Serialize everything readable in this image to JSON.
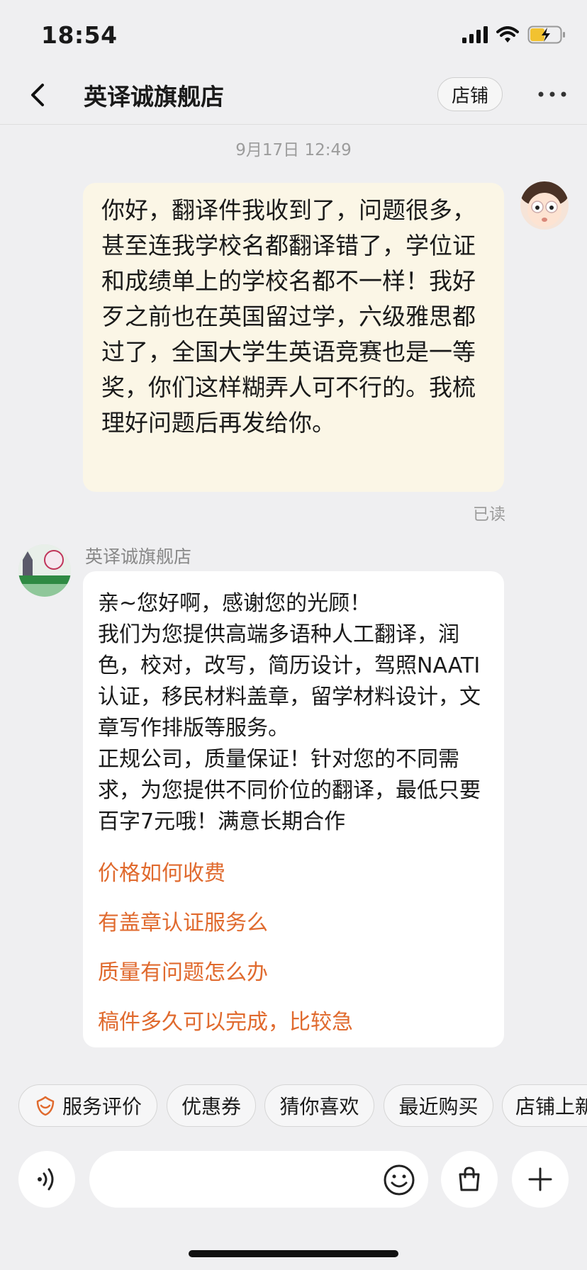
{
  "status_bar": {
    "time": "18:54",
    "icons": [
      "signal-icon",
      "wifi-icon",
      "battery-charging-icon"
    ]
  },
  "header": {
    "back_icon": "chevron-left-icon",
    "title": "英译诚旗舰店",
    "shop_button_label": "店铺",
    "more_icon": "more-dots-icon"
  },
  "chat": {
    "timestamp": "9月17日 12:49",
    "outgoing_message": {
      "text": "你好，翻译件我收到了，问题很多，甚至连我学校名都翻译错了，学位证和成绩单上的学校名都不一样！我好歹之前也在英国留过学，六级雅思都过了，全国大学生英语竞赛也是一等奖，你们这样糊弄人可不行的。我梳理好问题后再发给你。",
      "status": "已读"
    },
    "incoming_message": {
      "sender": "英译诚旗舰店",
      "lines": [
        "亲~您好啊，感谢您的光顾！",
        "我们为您提供高端多语种人工翻译，润色，校对，改写，简历设计，驾照NAATI认证，移民材料盖章，留学材料设计，文章写作排版等服务。",
        "正规公司，质量保证！针对您的不同需求，为您提供不同价位的翻译，最低只要百字7元哦！满意长期合作"
      ],
      "quick_replies": [
        "价格如何收费",
        "有盖章认证服务么",
        "质量有问题怎么办",
        "稿件多久可以完成，比较急"
      ]
    }
  },
  "chips": [
    "服务评价",
    "优惠券",
    "猜你喜欢",
    "最近购买",
    "店铺上新"
  ],
  "input_bar": {
    "placeholder": "",
    "voice_icon": "voice-icon",
    "emoji_icon": "emoji-icon",
    "bag_icon": "shopping-bag-icon",
    "plus_icon": "plus-icon"
  },
  "colors": {
    "accent": "#e06a2e",
    "outgoing_bubble": "#fbf6e6",
    "background": "#efeff1"
  }
}
